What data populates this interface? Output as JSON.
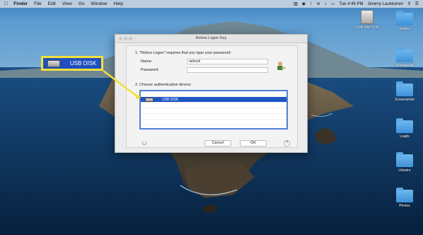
{
  "menubar": {
    "app": "Finder",
    "menus": [
      "File",
      "Edit",
      "View",
      "Go",
      "Window",
      "Help"
    ],
    "time": "Tue 4:46 PM",
    "user": "Jeremy Laukkonen"
  },
  "desktop": {
    "icons": [
      {
        "label": "USB RAPTOR",
        "kind": "drive"
      },
      {
        "label": "Stakes",
        "kind": "folder"
      },
      {
        "label": "Documents",
        "kind": "folder"
      },
      {
        "label": "Screenshots",
        "kind": "folder"
      },
      {
        "label": "Loads",
        "kind": "folder"
      },
      {
        "label": "Lifewire",
        "kind": "folder"
      },
      {
        "label": "Photos",
        "kind": "folder"
      }
    ]
  },
  "callout": {
    "label": "USB DISK",
    "color": "#1f4fbf",
    "border_color": "#f3e03a"
  },
  "dialog": {
    "title": "Rohos Logon Key",
    "step1": "1.  \"Rohos Logon\" requires that you type your password:",
    "name_label": "Name:",
    "name_value": "airbook",
    "password_label": "Password:",
    "password_value": "",
    "step2": "2.  Choose authentication device:",
    "devices": [
      "USB DISK"
    ],
    "cancel_label": "Cancel",
    "ok_label": "OK",
    "help_label": "?"
  }
}
